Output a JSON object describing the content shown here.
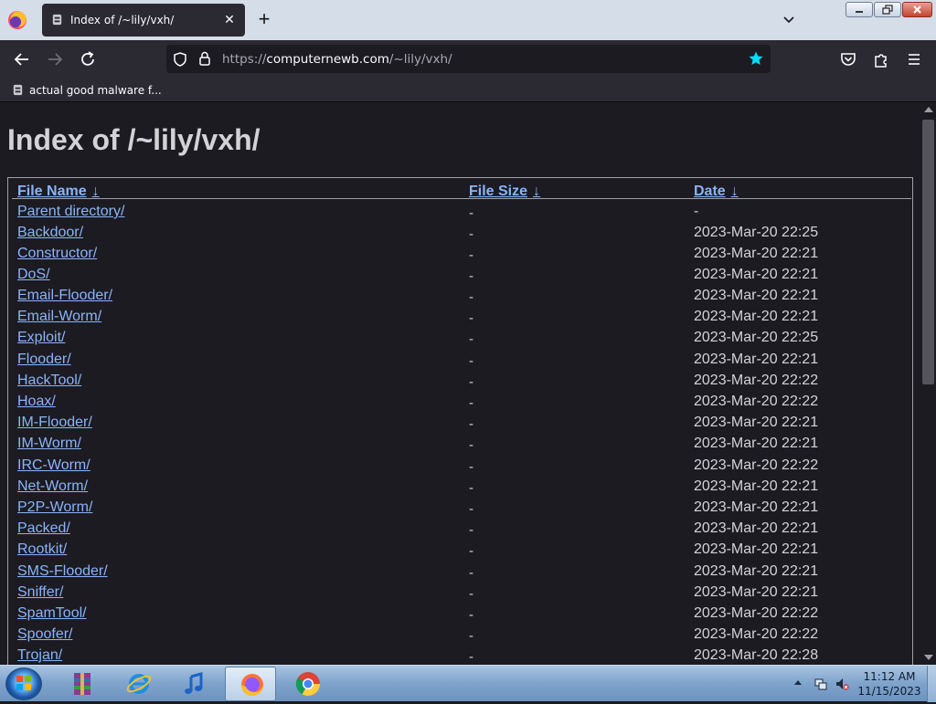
{
  "tab": {
    "title": "Index of /~lily/vxh/",
    "favicon": "rat-icon",
    "close": "✕"
  },
  "toolbar": {
    "new_tab": "+"
  },
  "url": {
    "scheme": "https://",
    "host": "computernewb.com",
    "path": "/~lily/vxh/"
  },
  "bookmarks": [
    {
      "label": "actual good malware f...",
      "icon": "rat-icon"
    }
  ],
  "page": {
    "title": "Index of /~lily/vxh/",
    "headers": {
      "name": "File Name",
      "size": "File Size",
      "date": "Date",
      "sort_arrow": "↓"
    },
    "rows": [
      {
        "name": "Parent directory/",
        "size": "-",
        "date": "-"
      },
      {
        "name": "Backdoor/",
        "size": "-",
        "date": "2023-Mar-20 22:25"
      },
      {
        "name": "Constructor/",
        "size": "-",
        "date": "2023-Mar-20 22:21"
      },
      {
        "name": "DoS/",
        "size": "-",
        "date": "2023-Mar-20 22:21"
      },
      {
        "name": "Email-Flooder/",
        "size": "-",
        "date": "2023-Mar-20 22:21"
      },
      {
        "name": "Email-Worm/",
        "size": "-",
        "date": "2023-Mar-20 22:21"
      },
      {
        "name": "Exploit/",
        "size": "-",
        "date": "2023-Mar-20 22:25"
      },
      {
        "name": "Flooder/",
        "size": "-",
        "date": "2023-Mar-20 22:21"
      },
      {
        "name": "HackTool/",
        "size": "-",
        "date": "2023-Mar-20 22:22"
      },
      {
        "name": "Hoax/",
        "size": "-",
        "date": "2023-Mar-20 22:22"
      },
      {
        "name": "IM-Flooder/",
        "size": "-",
        "date": "2023-Mar-20 22:21"
      },
      {
        "name": "IM-Worm/",
        "size": "-",
        "date": "2023-Mar-20 22:21"
      },
      {
        "name": "IRC-Worm/",
        "size": "-",
        "date": "2023-Mar-20 22:22"
      },
      {
        "name": "Net-Worm/",
        "size": "-",
        "date": "2023-Mar-20 22:21"
      },
      {
        "name": "P2P-Worm/",
        "size": "-",
        "date": "2023-Mar-20 22:21"
      },
      {
        "name": "Packed/",
        "size": "-",
        "date": "2023-Mar-20 22:21"
      },
      {
        "name": "Rootkit/",
        "size": "-",
        "date": "2023-Mar-20 22:21"
      },
      {
        "name": "SMS-Flooder/",
        "size": "-",
        "date": "2023-Mar-20 22:21"
      },
      {
        "name": "Sniffer/",
        "size": "-",
        "date": "2023-Mar-20 22:21"
      },
      {
        "name": "SpamTool/",
        "size": "-",
        "date": "2023-Mar-20 22:22"
      },
      {
        "name": "Spoofer/",
        "size": "-",
        "date": "2023-Mar-20 22:22"
      },
      {
        "name": "Trojan/",
        "size": "-",
        "date": "2023-Mar-20 22:28"
      }
    ]
  },
  "taskbar": {
    "apps": [
      "winrar-icon",
      "internet-explorer-icon",
      "itunes-icon",
      "firefox-icon",
      "chrome-icon"
    ],
    "active_app": "firefox-icon",
    "clock": {
      "time": "11:12 AM",
      "date": "11/15/2023"
    }
  },
  "colors": {
    "link": "#8ab4f8",
    "background": "#1c1b22",
    "toolbar": "#2b2a33",
    "bookmark_star": "#00ddff"
  }
}
